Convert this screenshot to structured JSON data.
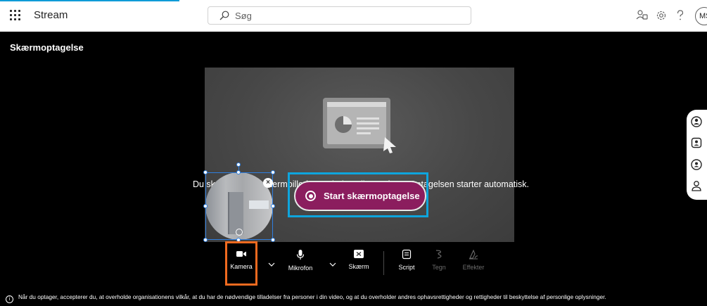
{
  "app": {
    "name": "Stream"
  },
  "search": {
    "placeholder": "Søg"
  },
  "header": {
    "avatar_initials": "MS"
  },
  "page": {
    "title": "Skærmoptagelse"
  },
  "main": {
    "message": "Du skal vælge et skærmbillede, et vindue eller en fane. Optagelsen starter automatisk.",
    "start_label": "Start skærmoptagelse"
  },
  "toolbar": {
    "camera": "Kamera",
    "microphone": "Mikrofon",
    "screen": "Skærm",
    "script": "Script",
    "draw": "Tegn",
    "effects": "Effekter"
  },
  "footer": {
    "notice": "Når du optager, accepterer du, at overholde organisationens vilkår, at du har de nødvendige tilladelser fra personer i din video, og at du overholder andres ophavsrettigheder og rettigheder til beskyttelse af personlige oplysninger."
  },
  "colors": {
    "accent_blue": "#0ea5dd",
    "start_button": "#8b1d5e",
    "camera_highlight": "#f06a1f",
    "selection_blue": "#2f7fe0"
  },
  "icons": {
    "waffle": "app-launcher-icon",
    "search": "search-icon",
    "share": "people-share-icon",
    "settings": "gear-icon",
    "help": "help-icon",
    "camera": "video-camera-icon",
    "microphone": "microphone-icon",
    "screen": "screen-share-icon",
    "script": "script-icon",
    "draw": "pen-icon",
    "effects": "effects-icon"
  }
}
